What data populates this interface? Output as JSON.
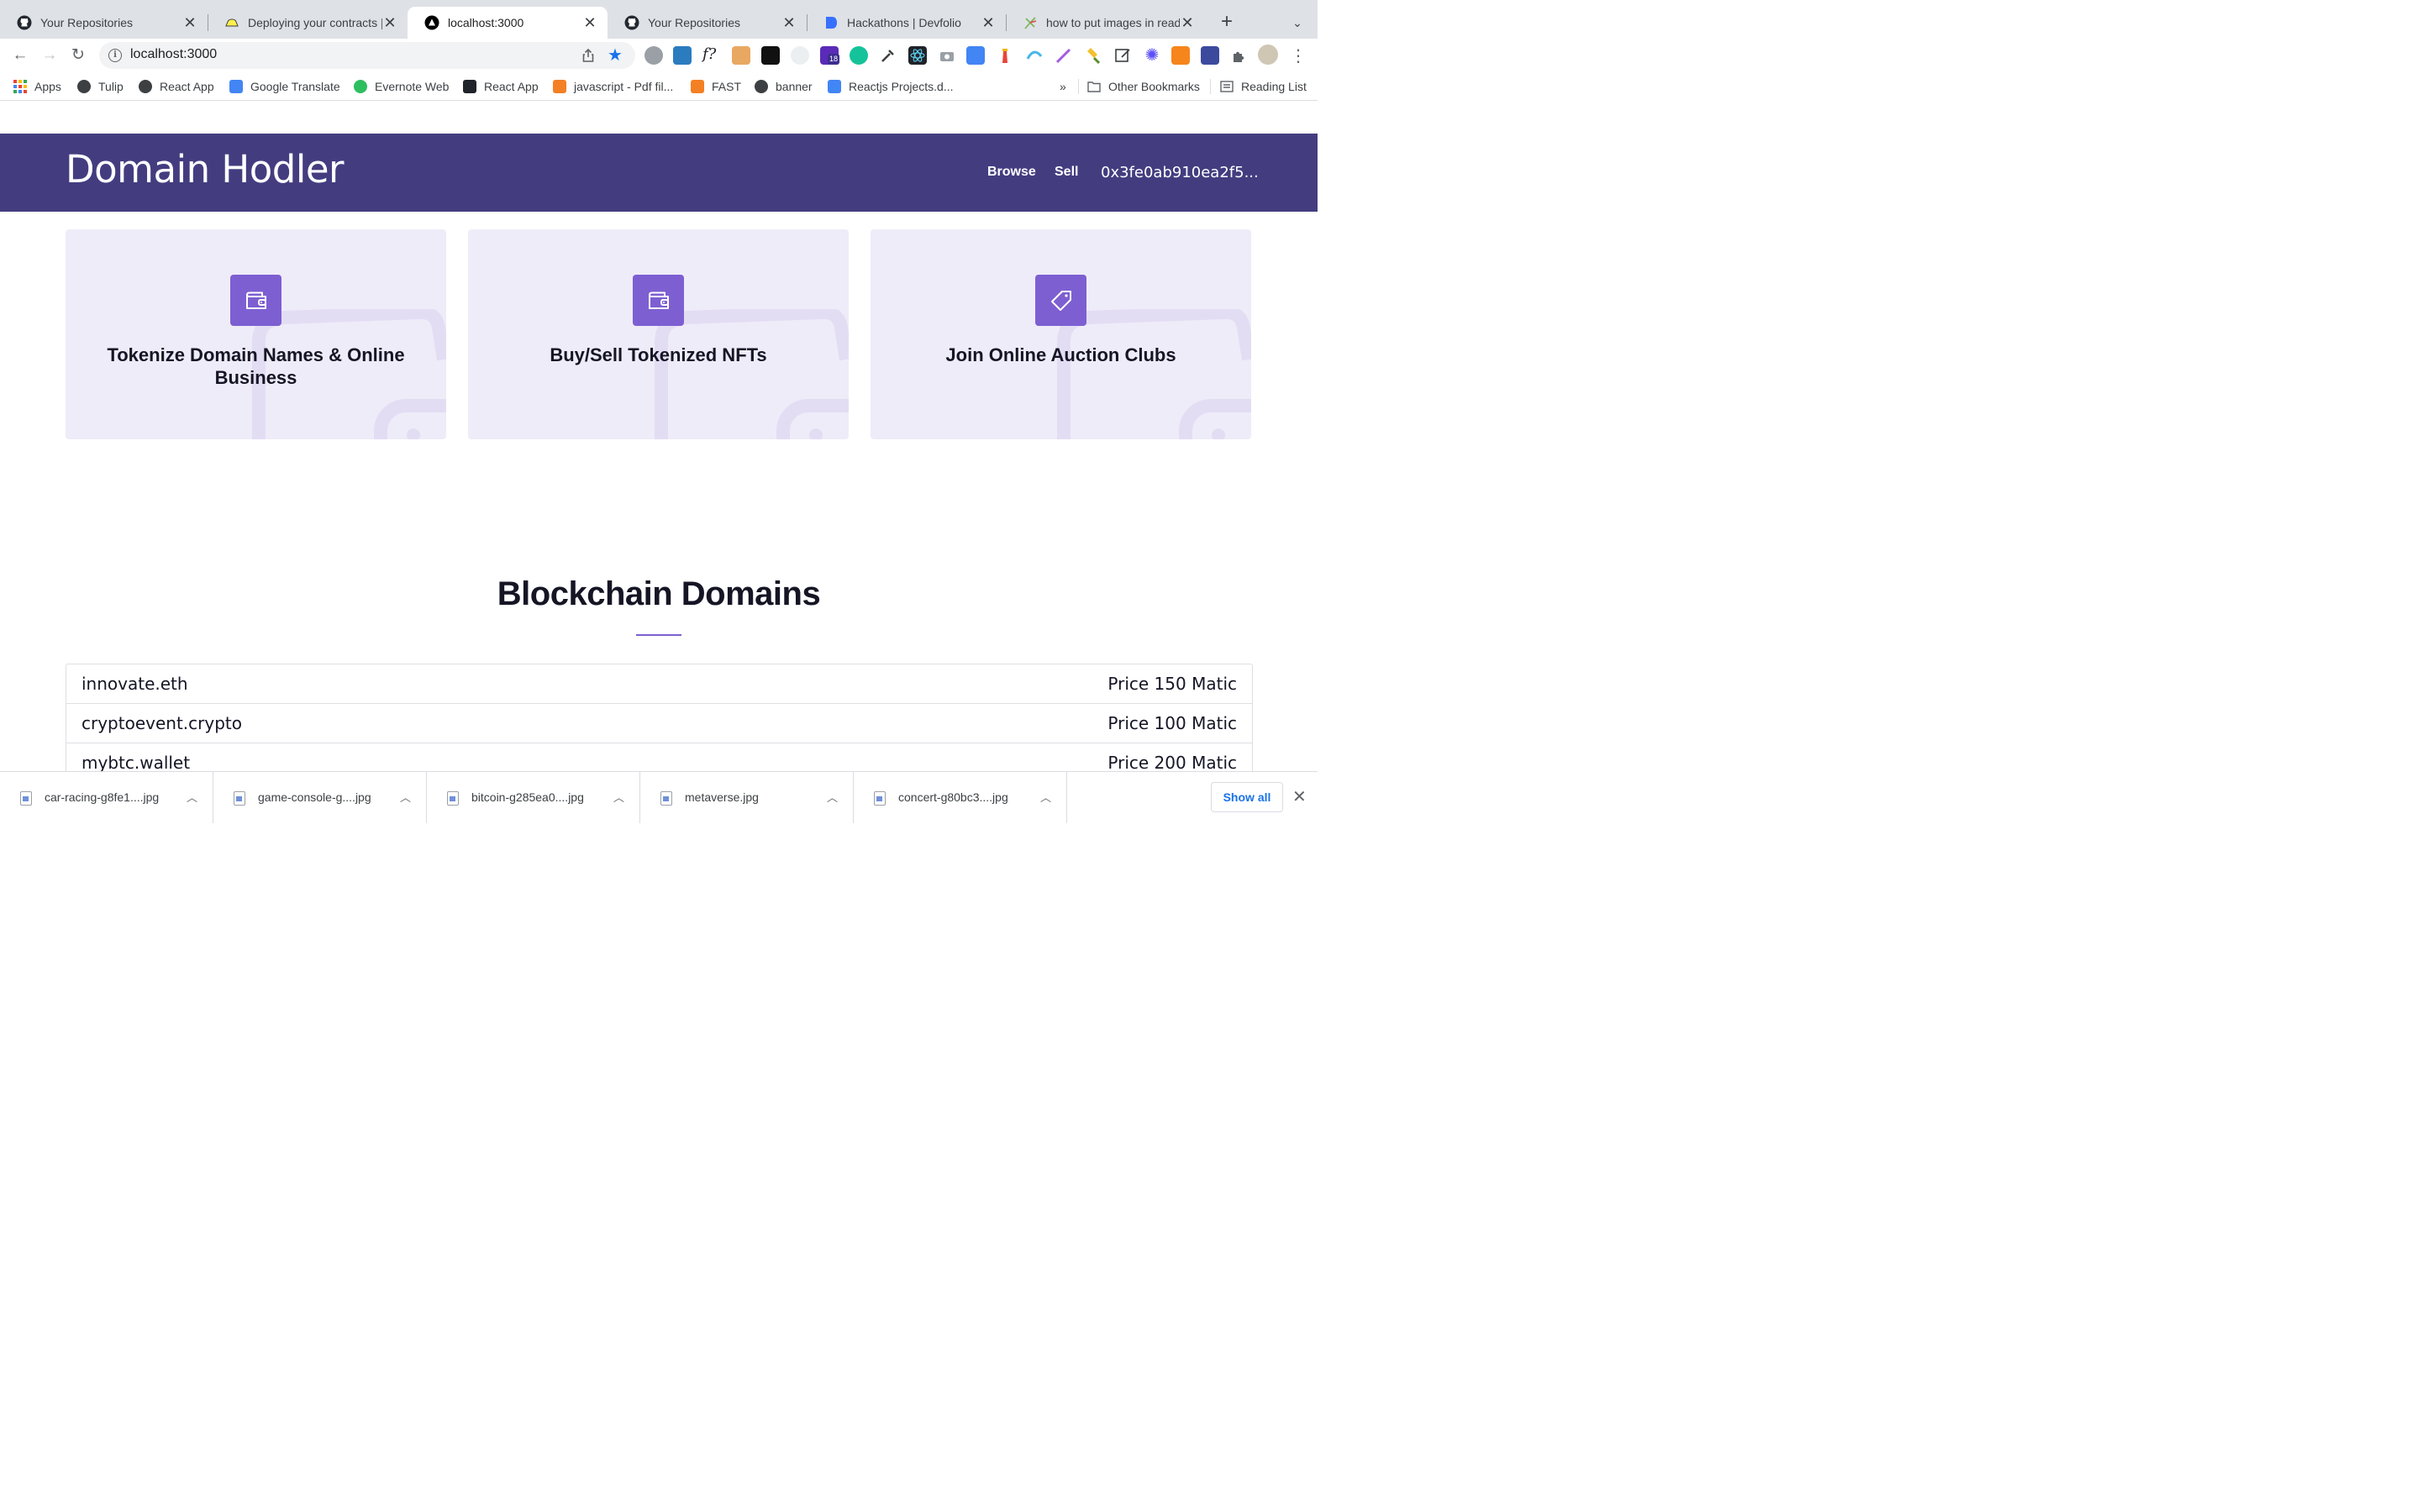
{
  "browser": {
    "tabs": [
      {
        "title": "Your Repositories",
        "icon": "github-icon",
        "active": false
      },
      {
        "title": "Deploying your contracts | P",
        "icon": "hardhat-icon",
        "active": false
      },
      {
        "title": "localhost:3000",
        "icon": "nextjs-icon",
        "active": true
      },
      {
        "title": "Your Repositories",
        "icon": "github-icon",
        "active": false
      },
      {
        "title": "Hackathons | Devfolio",
        "icon": "devfolio-icon",
        "active": false
      },
      {
        "title": "how to put images in readm",
        "icon": "stackoverflow-icon",
        "active": false
      }
    ],
    "new_tab": "+",
    "tab_menu": "⌄",
    "url": "localhost:3000",
    "accent": "#1a73e8",
    "bookmarks": [
      {
        "label": "Apps",
        "icon": "apps-grid-icon"
      },
      {
        "label": "Tulip",
        "icon": "globe-icon"
      },
      {
        "label": "React App",
        "icon": "globe-icon"
      },
      {
        "label": "Google Translate",
        "icon": "google-translate-icon"
      },
      {
        "label": "Evernote Web",
        "icon": "evernote-icon"
      },
      {
        "label": "React App",
        "icon": "react-icon"
      },
      {
        "label": "javascript - Pdf fil...",
        "icon": "stackoverflow-icon"
      },
      {
        "label": "FAST",
        "icon": "stackoverflow-icon"
      },
      {
        "label": "banner",
        "icon": "globe-icon"
      },
      {
        "label": "Reactjs Projects.d...",
        "icon": "google-docs-icon"
      }
    ],
    "more_bookmarks": "»",
    "other_bookmarks": "Other Bookmarks",
    "reading_list": "Reading List",
    "extension_badge": "18"
  },
  "site": {
    "brand": "Domain Hodler",
    "nav": {
      "browse": "Browse",
      "sell": "Sell",
      "wallet": "0x3fe0ab910ea2f5..."
    },
    "colors": {
      "header_bg": "#433d80",
      "card_bg": "#efecf9",
      "accent": "#7d5fd2"
    },
    "features": [
      {
        "title": "Tokenize Domain Names & Online Business",
        "icon": "wallet-icon"
      },
      {
        "title": "Buy/Sell Tokenized NFTs",
        "icon": "wallet-icon"
      },
      {
        "title": "Join Online Auction Clubs",
        "icon": "tag-icon"
      }
    ],
    "section_title": "Blockchain Domains",
    "domains": [
      {
        "name": "innovate.eth",
        "price": "Price 150 Matic"
      },
      {
        "name": "cryptoevent.crypto",
        "price": "Price 100 Matic"
      },
      {
        "name": "mybtc.wallet",
        "price": "Price 200 Matic"
      }
    ]
  },
  "downloads": {
    "items": [
      {
        "name": "car-racing-g8fe1....jpg"
      },
      {
        "name": "game-console-g....jpg"
      },
      {
        "name": "bitcoin-g285ea0....jpg"
      },
      {
        "name": "metaverse.jpg"
      },
      {
        "name": "concert-g80bc3....jpg"
      }
    ],
    "show_all": "Show all",
    "close": "✕"
  }
}
